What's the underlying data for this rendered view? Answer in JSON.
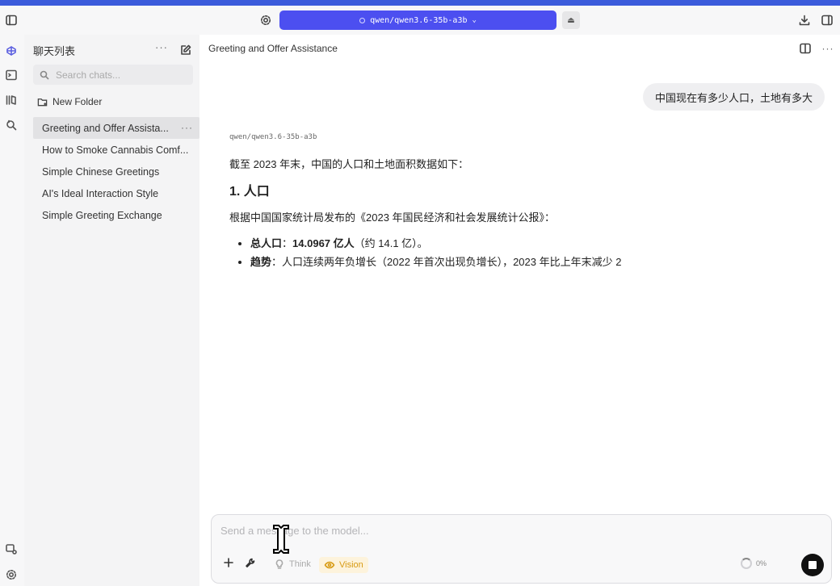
{
  "topbar": {
    "model_name": "qwen/qwen3.6-35b-a3b",
    "icons": [
      "sidebar-toggle-icon",
      "settings-icon",
      "eject-icon",
      "download-icon",
      "panel-icon"
    ]
  },
  "rail": {
    "icons": [
      "app-logo-icon",
      "terminal-icon",
      "library-icon",
      "search-models-icon",
      "developer-icon",
      "settings-icon"
    ]
  },
  "sidebar": {
    "title": "聊天列表",
    "search_placeholder": "Search chats...",
    "new_folder_label": "New Folder",
    "chats": [
      {
        "label": "Greeting and Offer Assista...",
        "active": true
      },
      {
        "label": "How to Smoke Cannabis Comf...",
        "active": false
      },
      {
        "label": "Simple Chinese Greetings",
        "active": false
      },
      {
        "label": "AI's Ideal Interaction Style",
        "active": false
      },
      {
        "label": "Simple Greeting Exchange",
        "active": false
      }
    ]
  },
  "conversation": {
    "title": "Greeting and Offer Assistance",
    "user_message": "中国现在有多少人口，土地有多大",
    "assistant": {
      "model_tag": "qwen/qwen3.6-35b-a3b",
      "intro": "截至 2023 年末，中国的人口和土地面积数据如下：",
      "heading": "1. 人口",
      "source_line": "根据中国国家统计局发布的《2023 年国民经济和社会发展统计公报》：",
      "bullet1_label": "总人口",
      "bullet1_sep": "：",
      "bullet1_value": "14.0967 亿人",
      "bullet1_note": "（约 14.1 亿）。",
      "bullet2_label": "趋势",
      "bullet2_sep": "：",
      "bullet2_text": "人口连续两年负增长（2022 年首次出现负增长），2023 年比上年末减少 2"
    }
  },
  "composer": {
    "placeholder": "Send a message to the model...",
    "think_label": "Think",
    "vision_label": "Vision",
    "context_usage": "0%"
  },
  "colors": {
    "accent": "#3b5bdb",
    "model_pill": "#4c4ff0",
    "vision": "#d79a13"
  }
}
